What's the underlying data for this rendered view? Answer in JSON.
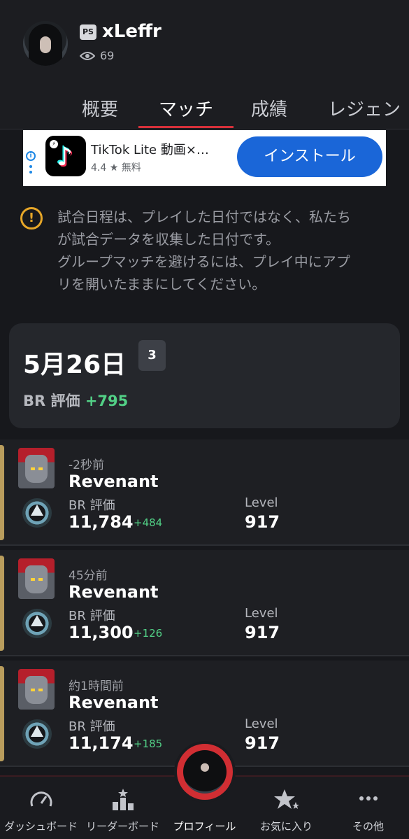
{
  "profile": {
    "username": "xLeffr",
    "platform_icon": "playstation-icon",
    "platform_glyph": "PS",
    "view_count": "69"
  },
  "tabs": [
    {
      "label": "概要",
      "active": false
    },
    {
      "label": "マッチ",
      "active": true
    },
    {
      "label": "成績",
      "active": false
    },
    {
      "label": "レジェン",
      "active": false
    }
  ],
  "ad": {
    "title": "TikTok Lite 動画×…",
    "rating": "4.4 ★ 無料",
    "button_label": "インストール",
    "info_glyph": "i"
  },
  "notice": {
    "icon_glyph": "!",
    "lines": [
      "試合日程は、プレイした日付ではなく、私たち",
      "が試合データを収集した日付です。",
      "グループマッチを避けるには、プレイ中にアプ",
      "リを開いたままにしてください。"
    ]
  },
  "day": {
    "date": "5月26日",
    "match_count": "3",
    "rating_label": "BR 評価",
    "rating_gain": "+795"
  },
  "matches": [
    {
      "time": "-2秒前",
      "legend": "Revenant",
      "br_label": "BR 評価",
      "br_value": "11,784",
      "br_gain": "+484",
      "level_label": "Level",
      "level_value": "917"
    },
    {
      "time": "45分前",
      "legend": "Revenant",
      "br_label": "BR 評価",
      "br_value": "11,300",
      "br_gain": "+126",
      "level_label": "Level",
      "level_value": "917"
    },
    {
      "time": "約1時間前",
      "legend": "Revenant",
      "br_label": "BR 評価",
      "br_value": "11,174",
      "br_gain": "+185",
      "level_label": "Level",
      "level_value": "917"
    }
  ],
  "bottom_nav": [
    {
      "label": "ダッシュボード",
      "icon": "speedometer-icon"
    },
    {
      "label": "リーダーボード",
      "icon": "leaderboard-icon"
    },
    {
      "label": "プロフィール",
      "icon": "profile-avatar",
      "active": true
    },
    {
      "label": "お気に入り",
      "icon": "stars-icon"
    },
    {
      "label": "その他",
      "icon": "more-icon"
    }
  ],
  "colors": {
    "accent_red": "#d6313a",
    "gain_green": "#52d086",
    "warning_amber": "#e6a628",
    "match_accent": "#b99d5d",
    "ad_blue": "#1a66d8"
  }
}
